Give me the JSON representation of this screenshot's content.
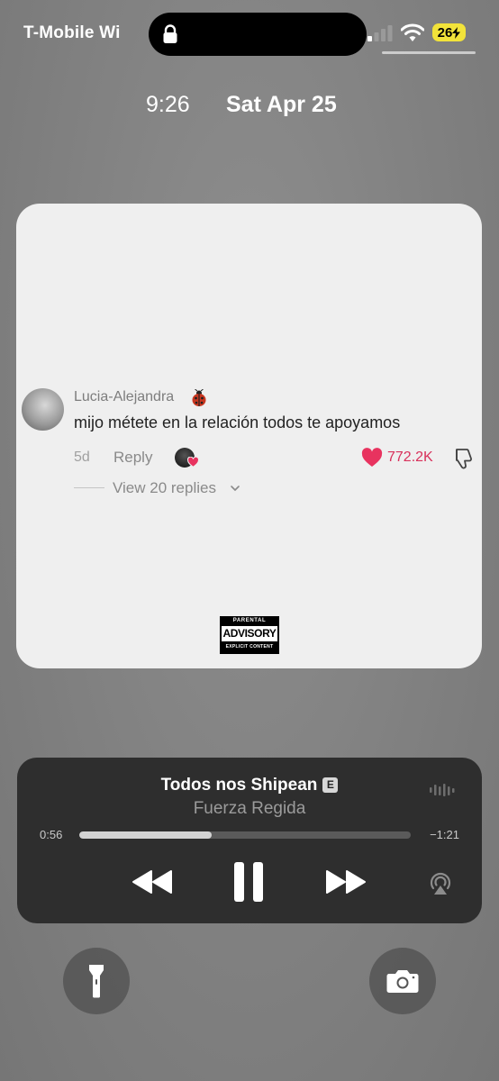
{
  "status_bar": {
    "carrier": "T-Mobile Wi",
    "battery": "26",
    "icons": [
      "lock-icon",
      "signal-icon",
      "wifi-icon",
      "battery-charging-icon"
    ]
  },
  "lock_screen": {
    "time": "9:26",
    "date": "Sat Apr 25"
  },
  "comment": {
    "username": "Lucia-Alejandra",
    "text": "mijo métete en la relación todos te apoyamos",
    "age": "5d",
    "reply_label": "Reply",
    "like_count": "772.2K",
    "view_replies_label": "View 20 replies"
  },
  "advisory": {
    "top": "PARENTAL",
    "middle": "ADVISORY",
    "bottom": "EXPLICIT CONTENT"
  },
  "player": {
    "title": "Todos nos Shipean",
    "explicit_badge": "E",
    "artist": "Fuerza Regida",
    "elapsed": "0:56",
    "remaining": "−1:21",
    "progress": 0.4
  },
  "controls": {
    "flashlight_icon": "flashlight-icon",
    "camera_icon": "camera-icon"
  },
  "colors": {
    "like_pink": "#d8315b",
    "battery_yellow": "#f2e33a"
  }
}
